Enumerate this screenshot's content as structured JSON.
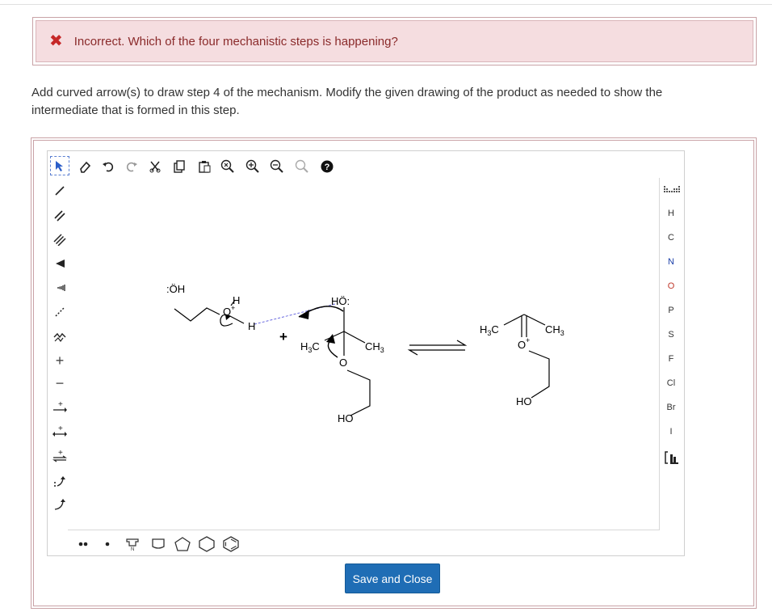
{
  "feedback": {
    "icon": "x-mark-icon",
    "icon_color": "#c62828",
    "text": "Incorrect. Which of the four mechanistic steps is happening?"
  },
  "instructions": {
    "line1": "Add curved arrow(s) to draw step 4 of the mechanism. Modify the given drawing of the product as needed to show the",
    "line2": "intermediate that is formed in this step."
  },
  "top_toolbar": [
    "select-icon",
    "eraser-icon",
    "undo-icon",
    "redo-icon",
    "cut-icon",
    "copy-icon",
    "paste-icon",
    "zoom-reset-icon",
    "zoom-in-icon",
    "zoom-out-icon",
    "search-icon",
    "help-icon"
  ],
  "left_toolbar": [
    "single-bond-icon",
    "double-bond-icon",
    "triple-bond-icon",
    "wedge-bond-icon",
    "hash-bond-icon",
    "dashed-bond-icon",
    "chain-icon",
    "positive-charge-icon",
    "negative-charge-icon",
    "reaction-arrow-icon",
    "resonance-arrow-icon",
    "equilibrium-arrow-icon",
    "curved-arrow-single-icon",
    "curved-arrow-double-icon"
  ],
  "element_palette": {
    "periodic_icon": "periodic-table-icon",
    "elements": [
      "H",
      "C",
      "N",
      "O",
      "P",
      "S",
      "F",
      "Cl",
      "Br",
      "I"
    ],
    "bracket_icon": "bracket-icon"
  },
  "bottom_toolbar": [
    "lone-pair-icon",
    "radical-icon",
    "cyclopropane-icon",
    "cyclobutane-icon",
    "cyclopentane-icon",
    "cyclohexane-icon",
    "benzene-icon"
  ],
  "molecules": {
    "reactant_oh": ":ÖH",
    "oxonium_h": "H",
    "oxonium_o": "O",
    "oxonium_plus": "+",
    "bridge_h": "H",
    "plus": "+",
    "ho_top": "HÖ:",
    "h3c_left": "H",
    "h3c_left_sub": "3",
    "h3c_left_c": "C",
    "ch3_left": "CH",
    "ch3_left_sub": "3",
    "ring_o": "O",
    "ho_bottom": "HO",
    "h3c_right": "H",
    "h3c_right_sub": "3",
    "h3c_right_c": "C",
    "ch3_right": "CH",
    "ch3_right_sub": "3",
    "oplus_right": "O",
    "oplus_right_plus": "+",
    "ho_right": "HO"
  },
  "save_button": "Save and Close",
  "colors": {
    "feedback_bg": "#f5dde0",
    "feedback_border": "#c9a2a6",
    "button_bg": "#1f6db5"
  }
}
